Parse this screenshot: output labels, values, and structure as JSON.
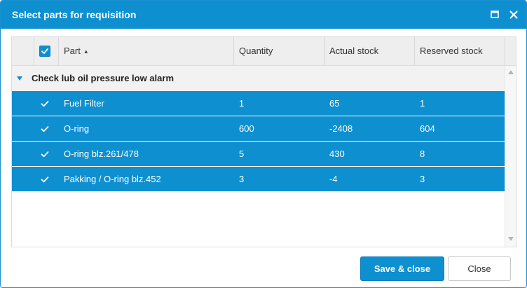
{
  "dialog": {
    "title": "Select parts for requisition",
    "icons": {
      "maximize": "maximize-icon",
      "close": "close-icon"
    }
  },
  "grid": {
    "header_checkbox_checked": true,
    "columns": [
      {
        "label": "Part",
        "sort": "ascending"
      },
      {
        "label": "Quantity"
      },
      {
        "label": "Actual stock"
      },
      {
        "label": "Reserved stock"
      }
    ],
    "group": {
      "label": "Check lub oil pressure low alarm",
      "expanded": true,
      "rows": [
        {
          "selected": true,
          "part": "Fuel Filter",
          "quantity": "1",
          "actual_stock": "65",
          "reserved_stock": "1"
        },
        {
          "selected": true,
          "part": "O-ring",
          "quantity": "600",
          "actual_stock": "-2408",
          "reserved_stock": "604"
        },
        {
          "selected": true,
          "part": "O-ring blz.261/478",
          "quantity": "5",
          "actual_stock": "430",
          "reserved_stock": "8"
        },
        {
          "selected": true,
          "part": "Pakking / O-ring blz.452",
          "quantity": "3",
          "actual_stock": "-4",
          "reserved_stock": "3"
        }
      ]
    }
  },
  "footer": {
    "save_close_label": "Save & close",
    "close_label": "Close"
  },
  "colors": {
    "accent": "#0e8fd0",
    "header_bg": "#eeeeee",
    "group_bg": "#f2f2f2"
  }
}
